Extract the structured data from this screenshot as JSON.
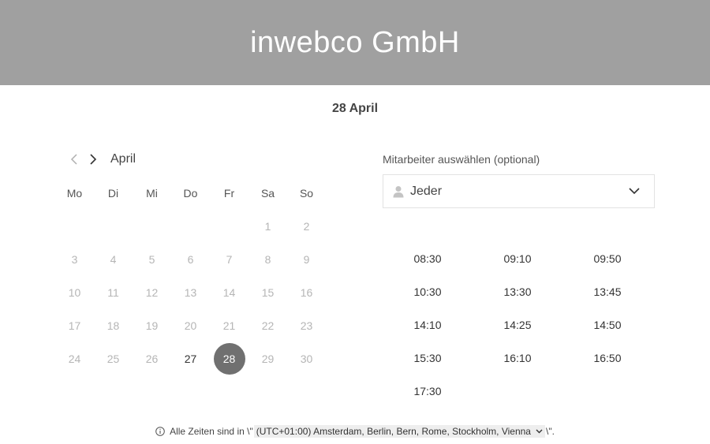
{
  "header": {
    "title": "inwebco GmbH"
  },
  "selected_date": "28 April",
  "calendar": {
    "month": "April",
    "prev_icon": "chevron-left-icon",
    "next_icon": "chevron-right-icon",
    "weekdays": [
      "Mo",
      "Di",
      "Mi",
      "Do",
      "Fr",
      "Sa",
      "So"
    ],
    "weeks": [
      [
        "",
        "",
        "",
        "",
        "",
        "1",
        "2"
      ],
      [
        "3",
        "4",
        "5",
        "6",
        "7",
        "8",
        "9"
      ],
      [
        "10",
        "11",
        "12",
        "13",
        "14",
        "15",
        "16"
      ],
      [
        "17",
        "18",
        "19",
        "20",
        "21",
        "22",
        "23"
      ],
      [
        "24",
        "25",
        "26",
        "27",
        "28",
        "29",
        "30"
      ]
    ],
    "available_days": [
      "27",
      "28"
    ],
    "selected_day": "28",
    "selected_color": "#707070"
  },
  "staff": {
    "label": "Mitarbeiter auswählen (optional)",
    "value": "Jeder",
    "icon": "person-icon"
  },
  "slots": [
    "08:30",
    "09:10",
    "09:50",
    "10:30",
    "13:30",
    "13:45",
    "14:10",
    "14:25",
    "14:50",
    "15:30",
    "16:10",
    "16:50",
    "17:30"
  ],
  "footer": {
    "prefix": "Alle Zeiten sind in \\\"",
    "timezone": "(UTC+01:00) Amsterdam, Berlin, Bern, Rome, Stockholm, Vienna",
    "suffix": "\\\".",
    "icon": "info-icon"
  },
  "colors": {
    "header_bg": "#a0a0a0",
    "selected_day_bg": "#707070"
  }
}
